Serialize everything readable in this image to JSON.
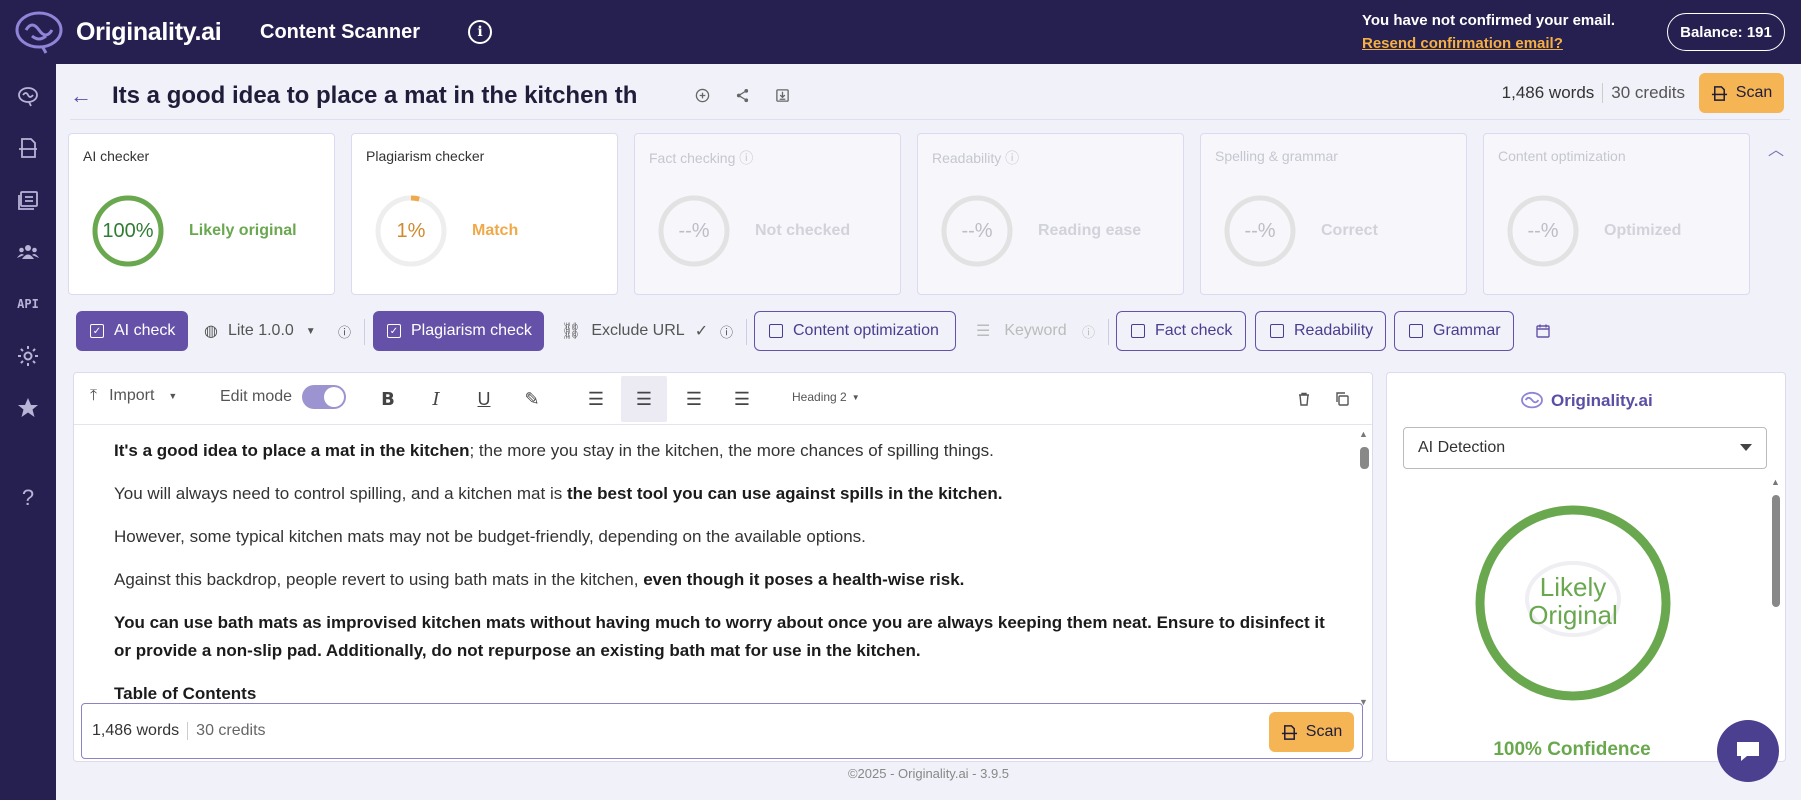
{
  "brand": {
    "logo_text": "Originality.ai",
    "app_title": "Content Scanner"
  },
  "topbar": {
    "email_notice": "You have not confirmed your email.",
    "resend_link": "Resend confirmation email?",
    "balance": "Balance: 191"
  },
  "sidebar": {
    "api_label": "API",
    "help_label": "?"
  },
  "document": {
    "title": "Its a good idea to place a mat in the kitchen th",
    "words": "1,486 words",
    "credits": "30 credits",
    "scan_label": "Scan"
  },
  "cards": [
    {
      "title": "AI checker",
      "value": "100%",
      "label": "Likely original",
      "color": "#6aa84f",
      "fill": 1.0
    },
    {
      "title": "Plagiarism checker",
      "value": "1%",
      "label": "Match",
      "color": "#f0a94a",
      "fill": 0.01
    },
    {
      "title": "Fact checking",
      "value": "--%",
      "label": "Not checked"
    },
    {
      "title": "Readability",
      "value": "--%",
      "label": "Reading ease"
    },
    {
      "title": "Spelling & grammar",
      "value": "--%",
      "label": "Correct"
    },
    {
      "title": "Content optimization",
      "value": "--%",
      "label": "Optimized"
    }
  ],
  "toolbar": {
    "ai_check": "AI check",
    "model": "Lite 1.0.0",
    "plagiarism_check": "Plagiarism check",
    "exclude_url": "Exclude URL",
    "content_optimization": "Content optimization",
    "keyword": "Keyword",
    "fact_check": "Fact check",
    "readability": "Readability",
    "grammar": "Grammar"
  },
  "editor": {
    "import": "Import",
    "edit_mode": "Edit mode",
    "heading": "Heading 2",
    "paragraphs": {
      "p1_bold": "It's a good idea to place a mat in the kitchen",
      "p1_rest": "; the more you stay in the kitchen, the more chances of spilling things.",
      "p2_start": "You will always need to control spilling, and a kitchen mat is ",
      "p2_bold": "the best tool you can use against spills in the kitchen.",
      "p3": "However, some typical kitchen mats may not be budget-friendly, depending on the available options.",
      "p4_start": "Against this backdrop, people revert to using bath mats in the kitchen, ",
      "p4_bold": "even though it poses a health-wise risk.",
      "p5_bold": "You can use bath mats as improvised kitchen mats without having much to worry about once you are always keeping them neat. Ensure to disinfect it or provide a non-slip pad. Additionally, do not repurpose an existing bath mat for use in the kitchen.",
      "p6_bold": "Table of Contents"
    }
  },
  "right_panel": {
    "logo_text": "Originality.ai",
    "select_value": "AI Detection",
    "ring_line1": "Likely",
    "ring_line2": "Original",
    "confidence": "100% Confidence"
  },
  "footer": "©2025 - Originality.ai - 3.9.5",
  "colors": {
    "brand_bg": "#262050",
    "accent": "#6552a8",
    "scan": "#f5b555",
    "success": "#6aa84f",
    "warning": "#f0a94a"
  }
}
